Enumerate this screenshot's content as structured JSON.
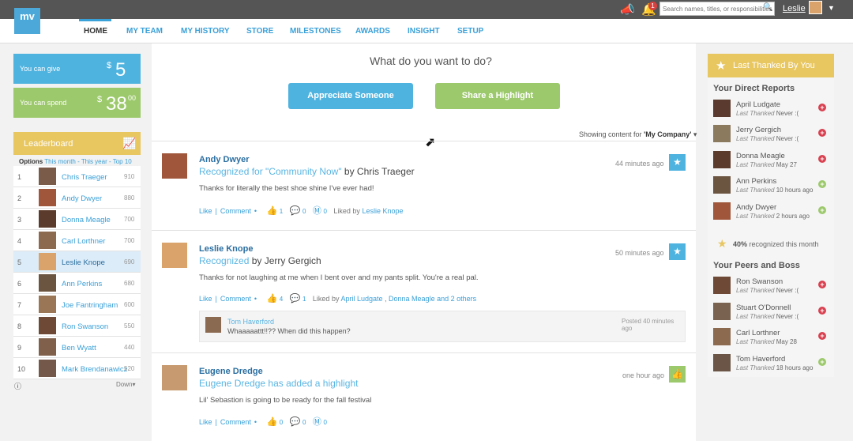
{
  "app": {
    "logo": "mv"
  },
  "topbar": {
    "notification_count": "1",
    "search_placeholder": "Search names, titles, or responsibilities",
    "user_name": "Leslie"
  },
  "nav": {
    "items": [
      "HOME",
      "MY TEAM",
      "MY HISTORY",
      "STORE",
      "MILESTONES",
      "AWARDS",
      "INSIGHT",
      "SETUP"
    ],
    "active": "HOME"
  },
  "wallet": {
    "give_label": "You can give",
    "give_currency": "$",
    "give_value": "5",
    "spend_label": "You can spend",
    "spend_currency": "$",
    "spend_value": "38",
    "spend_cents": "00"
  },
  "leaderboard": {
    "title": "Leaderboard",
    "options_label": "Options",
    "filter_month": "This month",
    "filter_sep1": " - ",
    "filter_year": "This year",
    "filter_sep2": " - ",
    "filter_top": "Top 10",
    "rows": [
      {
        "rank": "1",
        "name": "Chris Traeger",
        "score": "910"
      },
      {
        "rank": "2",
        "name": "Andy Dwyer",
        "score": "880"
      },
      {
        "rank": "3",
        "name": "Donna Meagle",
        "score": "700"
      },
      {
        "rank": "4",
        "name": "Carl Lorthner",
        "score": "700"
      },
      {
        "rank": "5",
        "name": "Leslie Knope",
        "score": "690"
      },
      {
        "rank": "6",
        "name": "Ann Perkins",
        "score": "680"
      },
      {
        "rank": "7",
        "name": "Joe Fantringham",
        "score": "600"
      },
      {
        "rank": "8",
        "name": "Ron Swanson",
        "score": "550"
      },
      {
        "rank": "9",
        "name": "Ben Wyatt",
        "score": "440"
      },
      {
        "rank": "10",
        "name": "Mark Brendanawicz",
        "score": "520"
      }
    ],
    "info_icon": "i",
    "down_label": "Down"
  },
  "center": {
    "question": "What do you want to do?",
    "appreciate_button": "Appreciate Someone",
    "highlight_button": "Share a Highlight",
    "showing_label": "Showing content for",
    "showing_value": "'My Company'"
  },
  "posts": [
    {
      "author": "Andy Dwyer",
      "recognized": "Recognized for \"Community Now\"",
      "by": " by Chris Traeger",
      "text": "Thanks for literally the best shoe shine I've ever had!",
      "time": "44 minutes ago",
      "like": "Like",
      "comment": "Comment",
      "likes": "1",
      "comments": "0",
      "bucks": "0",
      "liked_by_label": "Liked by",
      "liked_by": "Leslie Knope"
    },
    {
      "author": "Leslie Knope",
      "recognized": "Recognized",
      "by": " by Jerry Gergich",
      "text": "Thanks for not laughing at me when I bent over and my pants split. You're a real pal.",
      "time": "50 minutes ago",
      "like": "Like",
      "comment": "Comment",
      "likes": "4",
      "comments": "1",
      "liked_by_label": "Liked by",
      "liked_by": "April Ludgate",
      "liked_by_sep": " , ",
      "liked_by_2": "Donna Meagle and 2 others",
      "comment_entry": {
        "author": "Tom Haverford",
        "text": "Whaaaaattt!!?? When did this happen?",
        "time": "Posted 40 minutes ago"
      }
    },
    {
      "author": "Eugene Dredge",
      "recognized": "Eugene Dredge has added a highlight",
      "text": "Lil' Sebastion is going to be ready for the fall festival",
      "time": "one hour ago",
      "like": "Like",
      "comment": "Comment",
      "likes": "0",
      "comments": "0",
      "bucks": "0"
    }
  ],
  "right": {
    "header": "Last Thanked By You",
    "direct_title": "Your Direct Reports",
    "last_thanked_label": "Last Thanked",
    "direct": [
      {
        "name": "April Ludgate",
        "when": "Never :(",
        "action": "red"
      },
      {
        "name": "Jerry Gergich",
        "when": "Never :(",
        "action": "red"
      },
      {
        "name": "Donna Meagle",
        "when": "May 27",
        "action": "red"
      },
      {
        "name": "Ann Perkins",
        "when": "10 hours ago",
        "action": "green"
      },
      {
        "name": "Andy Dwyer",
        "when": "2 hours ago",
        "action": "green"
      }
    ],
    "percent": "40%",
    "percent_label": " recognized this month",
    "peers_title": "Your Peers and Boss",
    "peers": [
      {
        "name": "Ron Swanson",
        "when": "Never :(",
        "action": "red"
      },
      {
        "name": "Stuart O'Donnell",
        "when": "Never :(",
        "action": "red"
      },
      {
        "name": "Carl Lorthner",
        "when": "May 28",
        "action": "red"
      },
      {
        "name": "Tom Haverford",
        "when": "18 hours ago",
        "action": "green"
      }
    ]
  },
  "colors": {
    "accent_blue": "#4fb3e0",
    "accent_green": "#9cc96b",
    "accent_gold": "#e8c660",
    "remove_red": "#d94050"
  }
}
